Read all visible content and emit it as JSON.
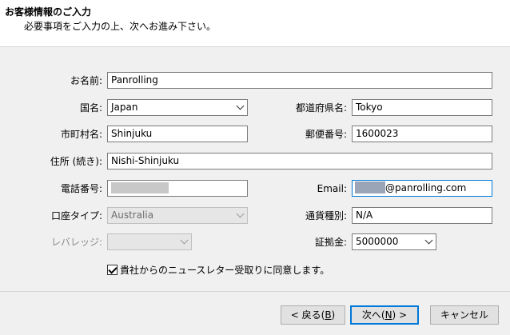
{
  "header": {
    "title": "お客様情報のご入力",
    "subtitle": "必要事項をご入力の上、次へお進み下さい。"
  },
  "form": {
    "name": {
      "label": "お名前:",
      "value": "Panrolling"
    },
    "country": {
      "label": "国名:",
      "value": "Japan"
    },
    "prefecture": {
      "label": "都道府県名:",
      "value": "Tokyo"
    },
    "city": {
      "label": "市町村名:",
      "value": "Shinjuku"
    },
    "postal": {
      "label": "郵便番号:",
      "value": "1600023"
    },
    "address": {
      "label": "住所 (続き):",
      "value": "Nishi-Shinjuku"
    },
    "phone": {
      "label": "電話番号:",
      "value": ""
    },
    "email": {
      "label": "Email:",
      "value": "@panrolling.com"
    },
    "account_type": {
      "label": "口座タイプ:",
      "value": "Australia"
    },
    "currency": {
      "label": "通貨種別:",
      "value": "N/A"
    },
    "leverage": {
      "label": "レバレッジ:",
      "value": ""
    },
    "deposit": {
      "label": "証拠金:",
      "value": "5000000"
    },
    "newsletter": {
      "label": "貴社からのニュースレター受取りに同意します。",
      "checked": true
    }
  },
  "buttons": {
    "back": {
      "pre": "< 戻る(",
      "key": "B",
      "post": ")"
    },
    "next": {
      "pre": "次へ(",
      "key": "N",
      "post": ") >"
    },
    "cancel": {
      "label": "キャンセル"
    }
  },
  "colors": {
    "focus_border": "#0078d7",
    "background": "#f0f0f0"
  }
}
